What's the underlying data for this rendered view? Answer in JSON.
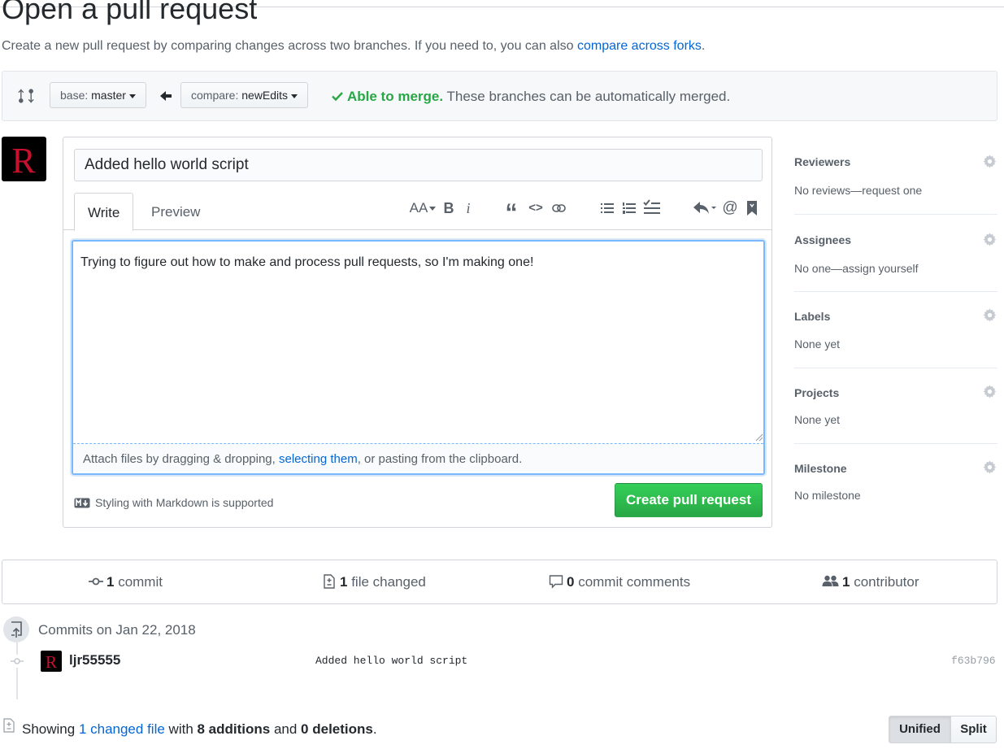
{
  "page": {
    "title": "Open a pull request",
    "subtitle_prefix": "Create a new pull request by comparing changes across two branches. If you need to, you can also ",
    "subtitle_link": "compare across forks",
    "subtitle_suffix": "."
  },
  "range": {
    "base_label": "base:",
    "base_value": "master",
    "compare_label": "compare:",
    "compare_value": "newEdits",
    "merge_ok": "Able to merge.",
    "merge_note": " These branches can be automatically merged."
  },
  "composer": {
    "title_value": "Added hello world script",
    "tabs": [
      {
        "label": "Write"
      },
      {
        "label": "Preview"
      }
    ],
    "body_value": "Trying to figure out how to make and process pull requests, so I'm making one!",
    "attach_prefix": "Attach files by dragging & dropping, ",
    "attach_link": "selecting them",
    "attach_suffix": ", or pasting from the clipboard.",
    "markdown_hint": "Styling with Markdown is supported",
    "submit_label": "Create pull request",
    "toolbar": {
      "header": "AA",
      "bold": "B",
      "italic": "i",
      "quote": "“",
      "code": "<>",
      "mention": "@"
    }
  },
  "sidebar": [
    {
      "heading": "Reviewers",
      "value": "No reviews—request one"
    },
    {
      "heading": "Assignees",
      "value": "No one—assign yourself"
    },
    {
      "heading": "Labels",
      "value": "None yet"
    },
    {
      "heading": "Projects",
      "value": "None yet"
    },
    {
      "heading": "Milestone",
      "value": "No milestone"
    }
  ],
  "summary": {
    "commits_count": "1",
    "commits_label": " commit",
    "files_count": "1",
    "files_label": " file changed",
    "comments_count": "0",
    "comments_label": " commit comments",
    "contributors_count": "1",
    "contributors_label": " contributor"
  },
  "commits": {
    "heading": "Commits on Jan 22, 2018",
    "items": [
      {
        "author": "ljr55555",
        "message": "Added hello world script",
        "sha": "f63b796"
      }
    ]
  },
  "diff": {
    "showing_prefix": "Showing ",
    "changed_link": "1 changed file",
    "with": " with ",
    "additions": "8 additions",
    "and": " and ",
    "deletions": "0 deletions",
    "end": ".",
    "unified_label": "Unified",
    "split_label": "Split"
  },
  "colors": {
    "accent": "#0366d6",
    "success": "#28a745",
    "avatar_letter": "#c8102e"
  },
  "avatar": {
    "letter": "R"
  }
}
